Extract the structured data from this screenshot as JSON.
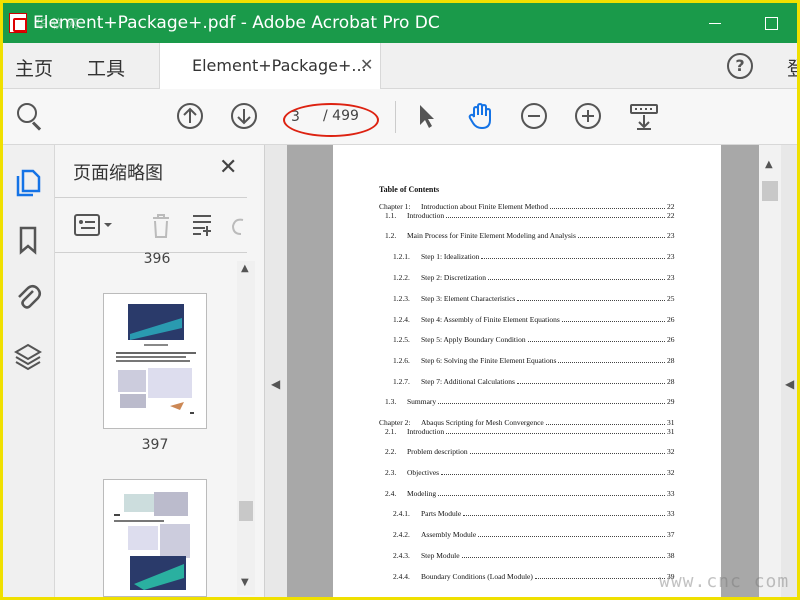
{
  "window": {
    "title": "Element+Package+.pdf - Adobe Acrobat Pro DC",
    "title_bar_color": "#1a9a4a"
  },
  "tabs": {
    "home": "主页",
    "tools": "工具",
    "document": "Element+Package+...",
    "login_partial": "登"
  },
  "toolbar": {
    "current_page": "3",
    "total_pages": "/ 499",
    "accent": "#1473e6"
  },
  "thumbnails": {
    "panel_title": "页面缩略图",
    "pages": [
      "396",
      "397"
    ]
  },
  "document": {
    "toc_title": "Table of Contents",
    "entries": [
      {
        "num": "Chapter 1:",
        "text": "Introduction about Finite Element Method",
        "page": "22",
        "level": 0
      },
      {
        "num": "1.1.",
        "text": "Introduction",
        "page": "22",
        "level": 1
      },
      {
        "num": "1.2.",
        "text": "Main Process for Finite Element Modeling and Analysis",
        "page": "23",
        "level": 1
      },
      {
        "num": "1.2.1.",
        "text": "Step 1: Idealization",
        "page": "23",
        "level": 2
      },
      {
        "num": "1.2.2.",
        "text": "Step 2: Discretization",
        "page": "23",
        "level": 2
      },
      {
        "num": "1.2.3.",
        "text": "Step 3: Element Characteristics",
        "page": "25",
        "level": 2
      },
      {
        "num": "1.2.4.",
        "text": "Step 4: Assembly of Finite Element Equations",
        "page": "26",
        "level": 2
      },
      {
        "num": "1.2.5.",
        "text": "Step 5: Apply Boundary Condition",
        "page": "26",
        "level": 2
      },
      {
        "num": "1.2.6.",
        "text": "Step 6: Solving the Finite Element Equations",
        "page": "28",
        "level": 2
      },
      {
        "num": "1.2.7.",
        "text": "Step 7: Additional Calculations",
        "page": "28",
        "level": 2
      },
      {
        "num": "1.3.",
        "text": "Summary",
        "page": "29",
        "level": 1
      },
      {
        "num": "Chapter 2:",
        "text": "Abaqus Scripting for Mesh Convergence",
        "page": "31",
        "level": 0
      },
      {
        "num": "2.1.",
        "text": "Introduction",
        "page": "31",
        "level": 1
      },
      {
        "num": "2.2.",
        "text": "Problem description",
        "page": "32",
        "level": 1
      },
      {
        "num": "2.3.",
        "text": "Objectives",
        "page": "32",
        "level": 1
      },
      {
        "num": "2.4.",
        "text": "Modeling",
        "page": "33",
        "level": 1
      },
      {
        "num": "2.4.1.",
        "text": "Parts Module",
        "page": "33",
        "level": 2
      },
      {
        "num": "2.4.2.",
        "text": "Assembly Module",
        "page": "37",
        "level": 2
      },
      {
        "num": "2.4.3.",
        "text": "Step Module",
        "page": "38",
        "level": 2
      },
      {
        "num": "2.4.4.",
        "text": "Boundary Conditions (Load Module)",
        "page": "39",
        "level": 2
      }
    ]
  },
  "watermarks": {
    "top": "华 软 网",
    "bottom": "www.cnc  com"
  }
}
